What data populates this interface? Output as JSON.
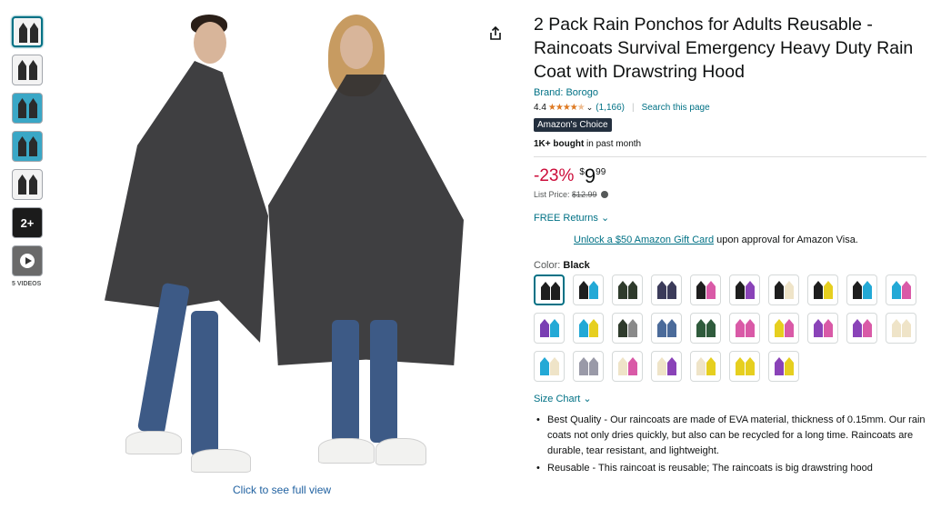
{
  "gallery": {
    "more_count": "2+",
    "videos_label": "5 VIDEOS",
    "click_full_view": "Click to see full view"
  },
  "product": {
    "title": "2 Pack Rain Ponchos for Adults Reusable - Raincoats Survival Emergency Heavy Duty Rain Coat with Drawstring Hood",
    "brand": "Brand: Borogo",
    "rating": "4.4",
    "rating_count": "(1,166)",
    "search_page": "Search this page",
    "badge": "Amazon's Choice",
    "bought_bold": "1K+ bought",
    "bought_rest": " in past month"
  },
  "price": {
    "discount": "-23%",
    "symbol": "$",
    "whole": "9",
    "fraction": "99",
    "list_label": "List Price: ",
    "list_value": "$12.99"
  },
  "returns": "FREE Returns",
  "gift": {
    "link": "Unlock a $50 Amazon Gift Card",
    "rest": " upon approval for Amazon Visa."
  },
  "color": {
    "label": "Color: ",
    "selected": "Black",
    "swatches": [
      [
        "#1e1e1e",
        "#1e1e1e"
      ],
      [
        "#1e1e1e",
        "#23a9d6"
      ],
      [
        "#2f3b2c",
        "#2f3b2c"
      ],
      [
        "#3b3b5a",
        "#3b3b5a"
      ],
      [
        "#1e1e1e",
        "#d95aa7"
      ],
      [
        "#1e1e1e",
        "#8a43b8"
      ],
      [
        "#1e1e1e",
        "#efe4c8"
      ],
      [
        "#1e1e1e",
        "#e6cf1f"
      ],
      [
        "#1e1e1e",
        "#23a9d6"
      ],
      [
        "#23a9d6",
        "#d95aa7"
      ],
      [
        "#7a3fb3",
        "#23a9d6"
      ],
      [
        "#23a9d6",
        "#e6cf1f"
      ],
      [
        "#2f3b2c",
        "#8a8a8a"
      ],
      [
        "#4b6b9a",
        "#4b6b9a"
      ],
      [
        "#2f5b3c",
        "#2f5b3c"
      ],
      [
        "#d95aa7",
        "#d95aa7"
      ],
      [
        "#e6cf1f",
        "#d95aa7"
      ],
      [
        "#8a43b8",
        "#d95aa7"
      ],
      [
        "#8a43b8",
        "#d95aa7"
      ],
      [
        "#efe4c8",
        "#efe4c8"
      ],
      [
        "#23a9d6",
        "#efe4c8"
      ],
      [
        "#9a9aa8",
        "#9a9aa8"
      ],
      [
        "#efe4c8",
        "#d95aa7"
      ],
      [
        "#efe4c8",
        "#8a43b8"
      ],
      [
        "#efe4c8",
        "#e6cf1f"
      ],
      [
        "#e6cf1f",
        "#e6cf1f"
      ],
      [
        "#8a43b8",
        "#e6cf1f"
      ]
    ]
  },
  "size_chart": "Size Chart",
  "bullets": [
    "Best Quality - Our raincoats are made of EVA material, thickness of 0.15mm. Our rain coats not only dries quickly, but also can be recycled for a long time. Raincoats are durable, tear resistant, and lightweight.",
    "Reusable - This raincoat is reusable; The raincoats is big drawstring hood"
  ],
  "icons": {
    "share": "share-icon",
    "chevron": "chevron-down-icon",
    "info": "info-icon",
    "play": "play-icon"
  }
}
